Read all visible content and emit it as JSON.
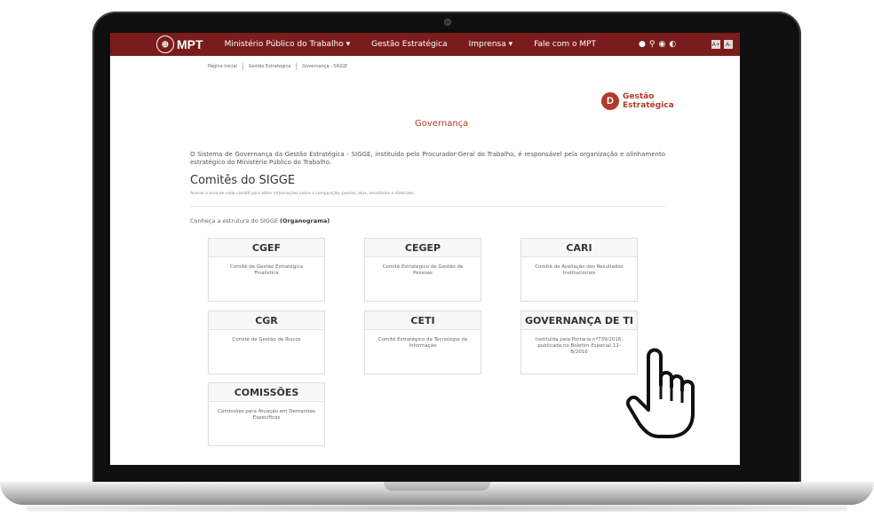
{
  "nav": {
    "logo": "MPT",
    "items": [
      "Ministério Público do Trabalho ▾",
      "Gestão Estratégica",
      "Imprensa ▾",
      "Fale com o MPT"
    ],
    "icons": [
      "info-icon",
      "search-icon",
      "sound-icon",
      "contrast-icon"
    ],
    "accessibility": [
      "A+",
      "A-"
    ]
  },
  "breadcrumb": [
    "Página inicial",
    "Gestão Estratégica",
    "Governança - SIGGE"
  ],
  "brand": {
    "line1": "Gestão",
    "line2": "Estratégica",
    "mark": "D"
  },
  "page_title": "Governança",
  "intro": "O Sistema de Governança da Gestão Estratégica - SIGGE, instituído pelo Procurador-Geral do Trabalho, é responsável pela organização e alinhamento estratégico do Ministério Público do Trabalho.",
  "section": {
    "title": "Comitês do SIGGE",
    "subtitle": "Acesse a área de cada comitê para obter informações sobre a composição, pautas, atas, resultados e diretrizes.",
    "org_prefix": "Conheça a estrutura do SIGGE ",
    "org_link": "(Organograma)"
  },
  "cards": [
    {
      "title": "CGEF",
      "desc": "Comitê de Gestão Estratégica Finalística"
    },
    {
      "title": "CEGEP",
      "desc": "Comitê Estratégico de Gestão de Pessoas"
    },
    {
      "title": "CARI",
      "desc": "Comitê de Avaliação dos Resultados Institucionais"
    },
    {
      "title": "CGR",
      "desc": "Comitê de Gestão de Riscos"
    },
    {
      "title": "CETI",
      "desc": "Comitê Estratégico de Tecnologia da Informação"
    },
    {
      "title": "GOVERNANÇA DE TI",
      "desc": "Instituída pela Portaria nº739/2016, publicada no Boletim Especial 12-B/2016"
    },
    {
      "title": "COMISSÕES",
      "desc": "Comissões para Atuação em Demandas Específicas"
    }
  ]
}
